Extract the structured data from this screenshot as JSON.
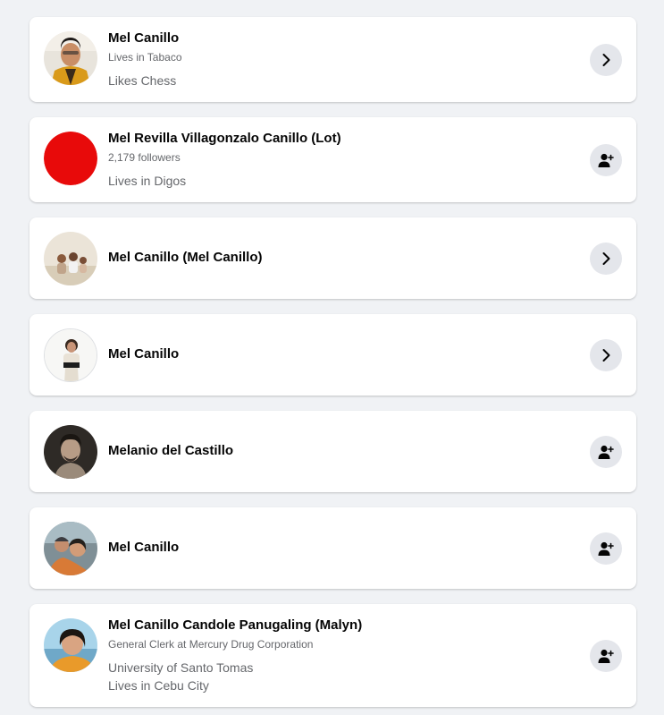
{
  "results": [
    {
      "name": "Mel Canillo",
      "subtitle": "Lives in Tabaco",
      "details": [
        "Likes Chess"
      ],
      "action": "chevron-right-icon"
    },
    {
      "name": "Mel Revilla Villagonzalo Canillo (Lot)",
      "subtitle": "2,179 followers",
      "details": [
        "Lives in Digos"
      ],
      "action": "add-friend-icon",
      "avatar_color": "#e80a0a"
    },
    {
      "name": "Mel Canillo (Mel Canillo)",
      "action": "chevron-right-icon"
    },
    {
      "name": "Mel Canillo",
      "action": "chevron-right-icon"
    },
    {
      "name": "Melanio del Castillo",
      "action": "add-friend-icon"
    },
    {
      "name": "Mel Canillo",
      "action": "add-friend-icon"
    },
    {
      "name": "Mel Canillo Candole Panugaling (Malyn)",
      "subtitle": "General Clerk at Mercury Drug Corporation",
      "details": [
        "University of Santo Tomas",
        "Lives in Cebu City"
      ],
      "action": "add-friend-icon"
    }
  ],
  "colors": {
    "page_background": "#f0f2f5",
    "card_background": "#ffffff",
    "action_button": "#e4e6eb",
    "primary_text": "#050505",
    "secondary_text": "#65676b"
  }
}
